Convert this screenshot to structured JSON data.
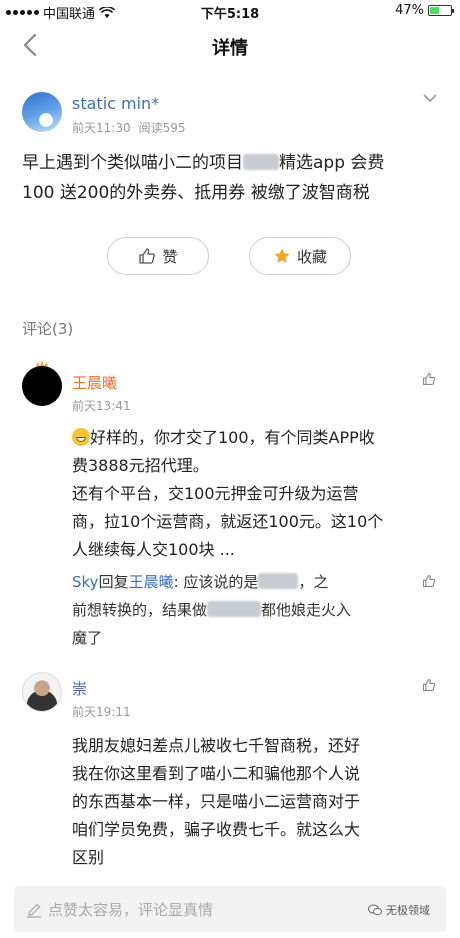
{
  "status_bar": {
    "carrier": "中国联通",
    "time": "下午5:18",
    "battery_text": "47%",
    "battery_level": 0.47
  },
  "nav": {
    "title": "详情"
  },
  "post": {
    "author": "static min*",
    "time": "前天11:30",
    "views": "阅读595",
    "body_line1_a": "早上遇到个类似喵小二的项目",
    "body_line1_b": "精选app 会费",
    "body_line2": "100 送200的外卖券、抵用券  被缴了波智商税"
  },
  "actions": {
    "like_label": "赞",
    "favorite_label": "收藏"
  },
  "comments_header": "评论(3)",
  "comments": [
    {
      "name": "王晨曦",
      "time": "前天13:41",
      "line1": "好样的，你才交了100，有个同类APP收",
      "line2": "费3888元招代理。",
      "line3": "还有个平台，交100元押金可升级为运营",
      "line4": "商，拉10个运营商，就返还100元。这10个",
      "line5": "人继续每人交100块 ...",
      "reply_from": "Sky",
      "reply_word": "回复",
      "reply_to": "王晨曦",
      "reply_a": ": 应该说的是",
      "reply_b": "，之",
      "reply_c": "前想转换的，结果做",
      "reply_d": "都他娘走火入",
      "reply_e": "魔了"
    },
    {
      "name": "崇",
      "time": "前天19:11",
      "line1": "我朋友媳妇差点儿被收七千智商税，还好",
      "line2": "我在你这里看到了喵小二和骗他那个人说",
      "line3": "的东西基本一样，只是喵小二运营商对于",
      "line4": "咱们学员免费，骗子收费七千。就这么大",
      "line5": "区别"
    }
  ],
  "bottom": {
    "placeholder": "点赞太容易，评论显真情",
    "watermark": "无极领域"
  }
}
